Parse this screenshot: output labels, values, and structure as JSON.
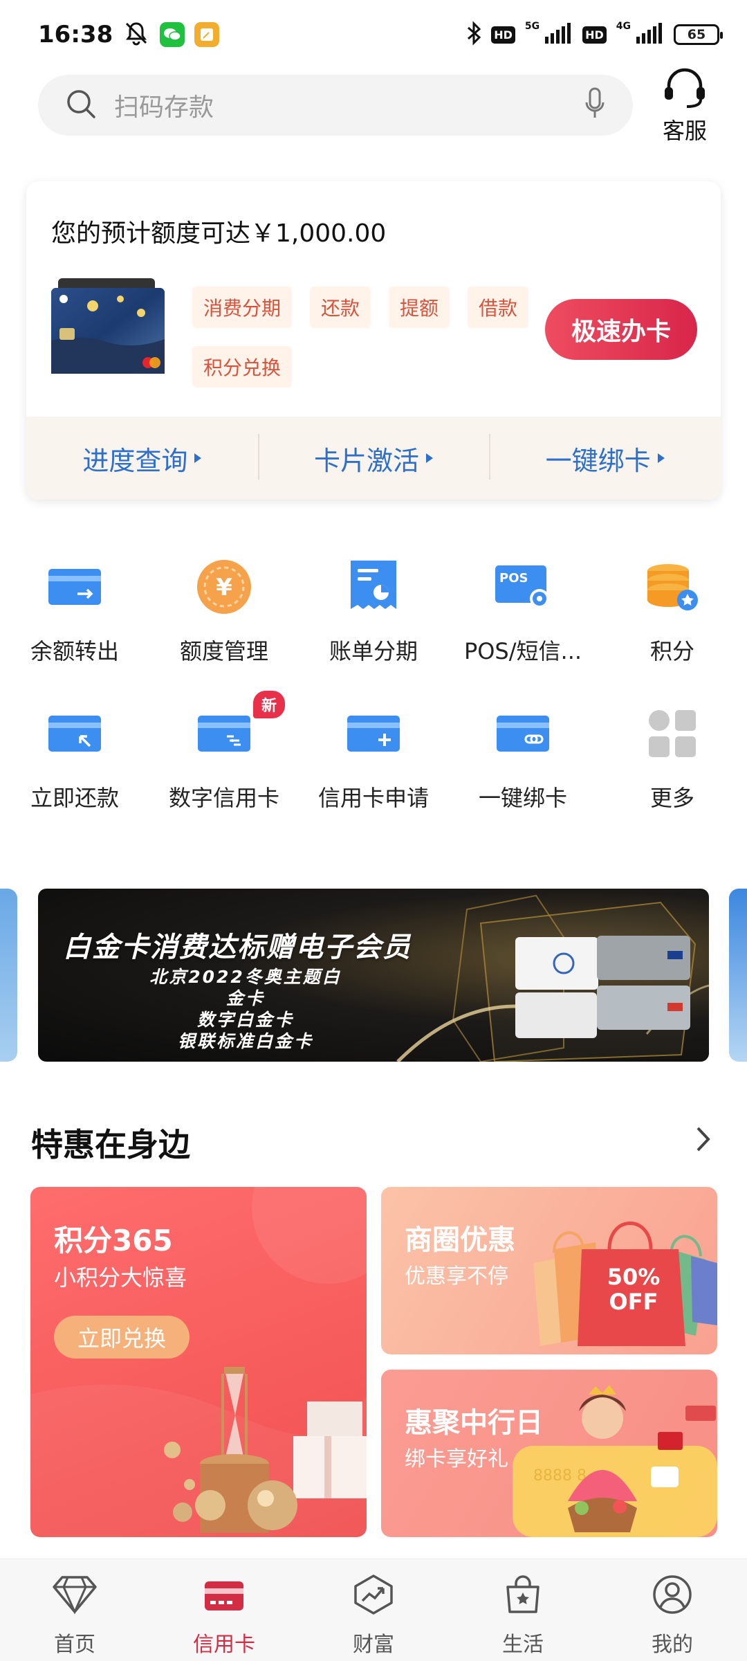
{
  "status_bar": {
    "time": "16:38",
    "hd1": "HD",
    "net1": "5G",
    "hd2": "HD",
    "net2": "4G",
    "battery": "65"
  },
  "search": {
    "placeholder": "扫码存款"
  },
  "service": {
    "label": "客服"
  },
  "card_block": {
    "title": "您的预计额度可达￥1,000.00",
    "tags": [
      "消费分期",
      "还款",
      "提额",
      "借款",
      "积分兑换"
    ],
    "apply_button": "极速办卡",
    "links": [
      "进度查询",
      "卡片激活",
      "一键绑卡"
    ]
  },
  "functions": [
    {
      "label": "余额转出",
      "icon": "transfer-out-icon"
    },
    {
      "label": "额度管理",
      "icon": "limit-yuan-icon"
    },
    {
      "label": "账单分期",
      "icon": "bill-installment-icon"
    },
    {
      "label": "POS/短信...",
      "icon": "pos-icon"
    },
    {
      "label": "积分",
      "icon": "points-coins-icon"
    },
    {
      "label": "立即还款",
      "icon": "repay-icon"
    },
    {
      "label": "数字信用卡",
      "icon": "digital-card-icon",
      "badge": "新"
    },
    {
      "label": "信用卡申请",
      "icon": "card-apply-icon"
    },
    {
      "label": "一键绑卡",
      "icon": "bind-card-icon"
    },
    {
      "label": "更多",
      "icon": "more-grid-icon"
    }
  ],
  "banner": {
    "title": "白金卡消费达标赠电子会员",
    "lines": [
      "北京2022冬奥主题白金卡",
      "数字白金卡",
      "银联标准白金卡"
    ]
  },
  "section": {
    "title": "特惠在身边"
  },
  "promos": {
    "points": {
      "title": "积分365",
      "subtitle": "小积分大惊喜",
      "button": "立即兑换"
    },
    "shopping": {
      "title": "商圈优惠",
      "subtitle": "优惠享不停",
      "tag_line1": "50%",
      "tag_line2": "OFF"
    },
    "bank_day": {
      "title": "惠聚中行日",
      "subtitle": "绑卡享好礼"
    }
  },
  "bottom_nav": [
    {
      "label": "首页",
      "icon": "diamond-icon"
    },
    {
      "label": "信用卡",
      "icon": "credit-card-icon",
      "active": true
    },
    {
      "label": "财富",
      "icon": "wealth-chart-icon"
    },
    {
      "label": "生活",
      "icon": "shopping-bag-star-icon"
    },
    {
      "label": "我的",
      "icon": "user-profile-icon"
    }
  ],
  "colors": {
    "accent_red": "#d22d45",
    "link_blue": "#2d6fcc",
    "tag_orange": "#d9533c"
  }
}
